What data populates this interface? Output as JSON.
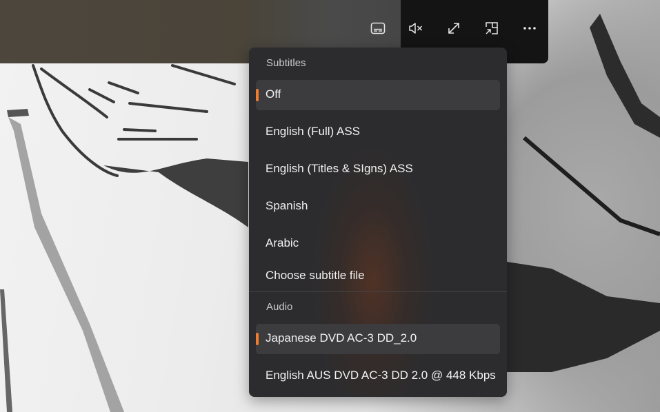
{
  "controls": {
    "subtitles_button": "subtitles",
    "mute_button": "mute",
    "fullscreen_button": "fullscreen",
    "miniplayer_button": "compact-overlay",
    "more_button": "more-options"
  },
  "menu": {
    "subtitles_header": "Subtitles",
    "subtitles": [
      {
        "label": "Off",
        "selected": true
      },
      {
        "label": "English (Full) ASS",
        "selected": false
      },
      {
        "label": "English (Titles & SIgns) ASS",
        "selected": false
      },
      {
        "label": "Spanish",
        "selected": false
      },
      {
        "label": "Arabic",
        "selected": false
      },
      {
        "label": "Choose subtitle file",
        "selected": false
      }
    ],
    "audio_header": "Audio",
    "audio": [
      {
        "label": "Japanese DVD AC-3 DD_2.0",
        "selected": true
      },
      {
        "label": "English AUS DVD AC-3 DD 2.0 @ 448 Kbps",
        "selected": false
      }
    ]
  },
  "colors": {
    "accent": "#f07d2e",
    "menu_bg": "#2c2c2e",
    "selected_bg": "#3c3c3e",
    "control_bar": "#141414"
  }
}
